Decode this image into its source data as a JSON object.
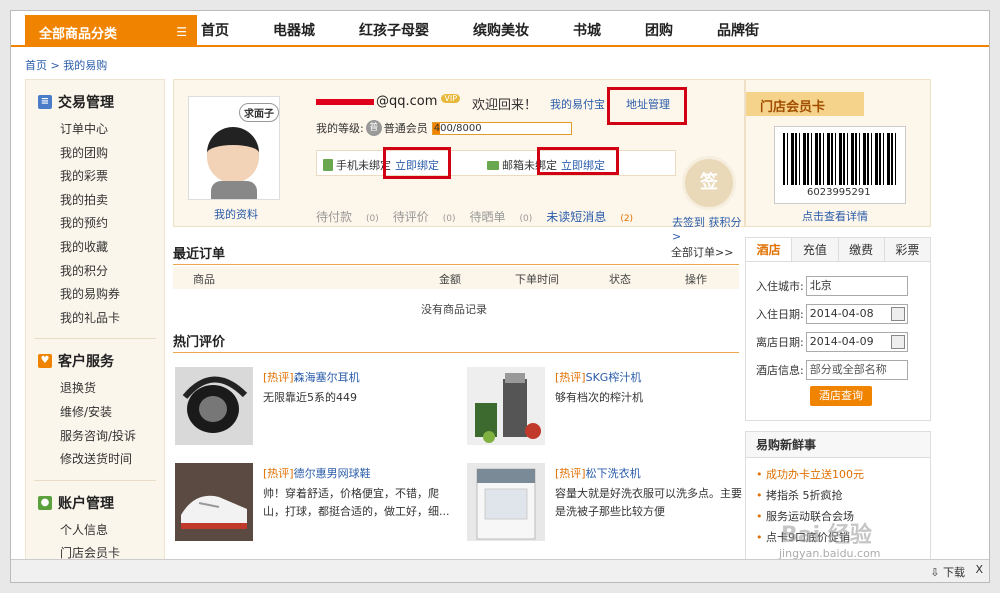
{
  "nav": {
    "category": "全部商品分类",
    "items": [
      "首页",
      "电器城",
      "红孩子母婴",
      "缤购美妆",
      "书城",
      "团购",
      "品牌街"
    ]
  },
  "breadcrumb": [
    "首页",
    "我的易购"
  ],
  "sidebar": {
    "groups": [
      {
        "title": "交易管理",
        "items": [
          "订单中心",
          "我的团购",
          "我的彩票",
          "我的拍卖",
          "我的预约",
          "我的收藏",
          "我的积分",
          "我的易购券",
          "我的礼品卡"
        ]
      },
      {
        "title": "客户服务",
        "items": [
          "退换货",
          "维修/安装",
          "服务咨询/投诉",
          "修改送货时间"
        ]
      },
      {
        "title": "账户管理",
        "items": [
          "个人信息",
          "门店会员卡"
        ]
      }
    ]
  },
  "profile": {
    "avatar_bubble": "求面子",
    "my_info": "我的资料",
    "email_suffix": "@qq.com",
    "vip": "VIP",
    "welcome": "欢迎回来！",
    "link_pay": "我的易付宝",
    "link_address": "地址管理",
    "level_label": "我的等级:",
    "level_badge": "普",
    "level_name": "普通会员",
    "level_progress": "400/8000",
    "level_fraction": 0.05,
    "phone_unbound": "手机未绑定",
    "bind_now_1": "立即绑定",
    "email_unbound": "邮箱未绑定",
    "bind_now_2": "立即绑定",
    "stats": [
      {
        "label": "待付款",
        "count": "(0)"
      },
      {
        "label": "待评价",
        "count": "(0)"
      },
      {
        "label": "待晒单",
        "count": "(0)"
      },
      {
        "label": "未读短消息",
        "count": "(2)"
      }
    ],
    "sign_glyph": "签",
    "sign_text": "去签到 获积分>"
  },
  "orders": {
    "title": "最近订单",
    "all_link": "全部订单>>",
    "columns": [
      "商品",
      "金额",
      "下单时间",
      "状态",
      "操作"
    ],
    "empty": "没有商品记录"
  },
  "reviews": {
    "title": "热门评价",
    "tag": "[热评]",
    "items": [
      {
        "name": "森海塞尔耳机",
        "desc": "无限靠近5系的449"
      },
      {
        "name": "SKG榨汁机",
        "desc": "够有档次的榨汁机"
      },
      {
        "name": "德尔惠男网球鞋",
        "desc": "帅！穿着舒适，价格便宜，不错，爬山，打球，都挺合适的，做工好，细..."
      },
      {
        "name": "松下洗衣机",
        "desc": "容量大就是好洗衣服可以洗多点。主要是洗被子那些比较方便"
      }
    ]
  },
  "card": {
    "title": "门店会员卡",
    "barcode_number": "6023995291",
    "link": "点击查看详情"
  },
  "hotel": {
    "tabs": [
      "酒店",
      "充值",
      "缴费",
      "彩票"
    ],
    "city_label": "入住城市:",
    "city_value": "北京",
    "checkin_label": "入住日期:",
    "checkin_value": "2014-04-08",
    "checkout_label": "离店日期:",
    "checkout_value": "2014-04-09",
    "info_label": "酒店信息:",
    "info_placeholder": "部分或全部名称",
    "search_button": "酒店查询"
  },
  "news": {
    "title": "易购新鲜事",
    "items": [
      "成功办卡立送100元",
      "拷指杀 5折疯抢",
      "服务运动联合会场",
      "点卡9口底价促销"
    ]
  },
  "statusbar": {
    "download": "下载",
    "close": "X"
  },
  "watermark": {
    "main": "Bai 经验",
    "url": "jingyan.baidu.com"
  },
  "colors": {
    "accent": "#f08300",
    "link": "#2a5caa",
    "highlight": "#d10012"
  }
}
